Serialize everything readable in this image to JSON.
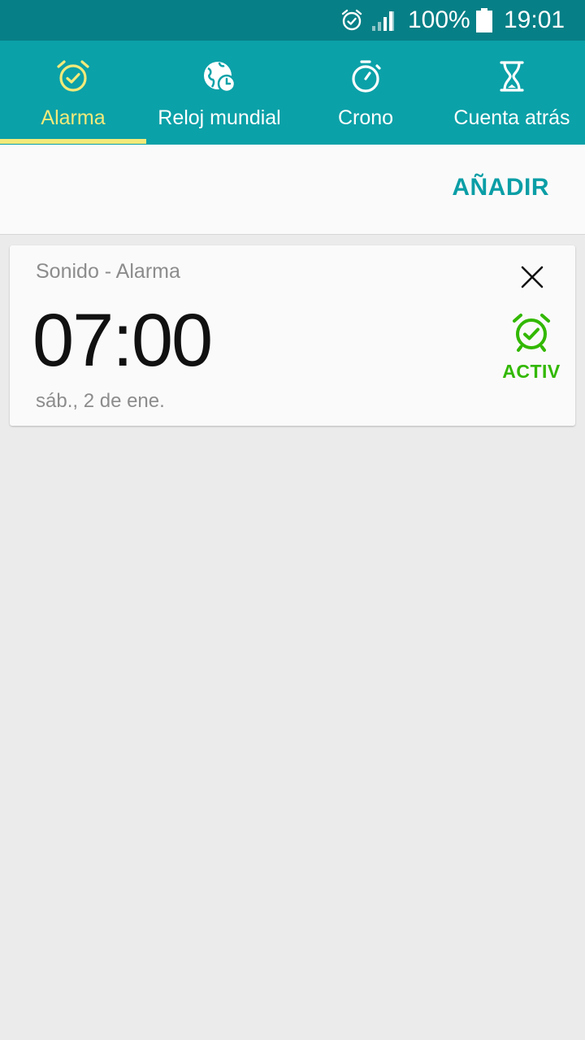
{
  "status_bar": {
    "battery": "100%",
    "time": "19:01",
    "icons": [
      "alarm-icon",
      "signal-icon",
      "battery-icon"
    ]
  },
  "tabs": [
    {
      "label": "Alarma",
      "icon": "alarm-clock-icon",
      "active": true
    },
    {
      "label": "Reloj mundial",
      "icon": "world-clock-icon",
      "active": false
    },
    {
      "label": "Crono",
      "icon": "stopwatch-icon",
      "active": false
    },
    {
      "label": "Cuenta atrás",
      "icon": "hourglass-icon",
      "active": false
    }
  ],
  "action_bar": {
    "add_label": "AÑADIR"
  },
  "alarm": {
    "name": "Sonido - Alarma",
    "time": "07:00",
    "date": "sáb., 2 de ene.",
    "status_label": "ACTIV",
    "enabled": true
  },
  "colors": {
    "status_bar": "#077f86",
    "tab_bar": "#0ba1a8",
    "active_tab": "#f2ea7a",
    "accent": "#0b9ea6",
    "active_alarm": "#32b800",
    "background": "#ebebeb"
  }
}
